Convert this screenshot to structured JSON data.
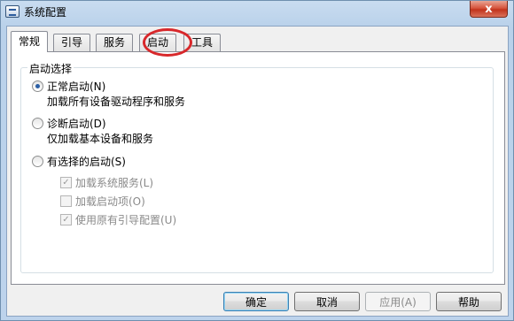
{
  "window": {
    "title": "系统配置",
    "close_glyph": "x"
  },
  "tabs": [
    {
      "label": "常规",
      "active": true
    },
    {
      "label": "引导",
      "active": false
    },
    {
      "label": "服务",
      "active": false
    },
    {
      "label": "启动",
      "active": false,
      "highlighted": true
    },
    {
      "label": "工具",
      "active": false
    }
  ],
  "startup_selection": {
    "legend": "启动选择",
    "options": [
      {
        "label": "正常启动(N)",
        "description": "加载所有设备驱动程序和服务",
        "selected": true
      },
      {
        "label": "诊断启动(D)",
        "description": "仅加载基本设备和服务",
        "selected": false
      },
      {
        "label": "有选择的启动(S)",
        "description": "",
        "selected": false
      }
    ],
    "selective_items": [
      {
        "label": "加载系统服务(L)",
        "checked": true,
        "enabled": false
      },
      {
        "label": "加载启动项(O)",
        "checked": false,
        "enabled": false
      },
      {
        "label": "使用原有引导配置(U)",
        "checked": true,
        "enabled": false
      }
    ]
  },
  "buttons": {
    "ok": "确定",
    "cancel": "取消",
    "apply": "应用(A)",
    "help": "帮助"
  },
  "colors": {
    "highlight_circle": "#d8282b",
    "selected_radio": "#2b5fa5"
  }
}
